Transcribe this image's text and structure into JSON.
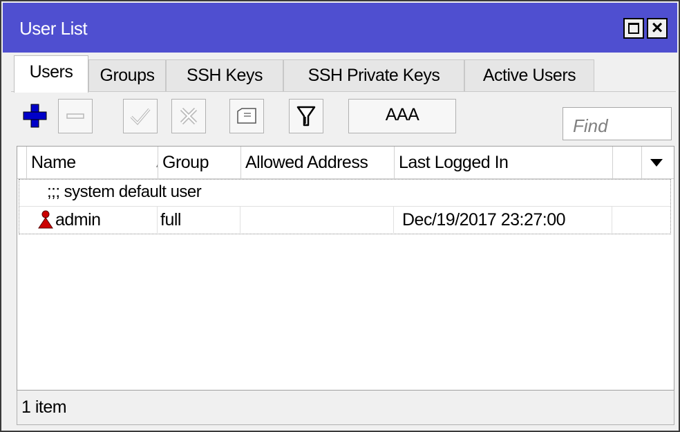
{
  "window": {
    "title": "User List"
  },
  "tabs": [
    {
      "label": "Users",
      "active": true
    },
    {
      "label": "Groups",
      "active": false
    },
    {
      "label": "SSH Keys",
      "active": false
    },
    {
      "label": "SSH Private Keys",
      "active": false
    },
    {
      "label": "Active Users",
      "active": false
    }
  ],
  "toolbar": {
    "icons": [
      "add-icon",
      "remove-icon",
      "enable-icon",
      "disable-icon",
      "comment-icon",
      "filter-icon"
    ],
    "aaa_label": "AAA",
    "find_placeholder": "Find"
  },
  "table": {
    "columns": [
      "Name",
      "Group",
      "Allowed Address",
      "Last Logged In"
    ],
    "rows": [
      {
        "comment": ";;; system default user",
        "name": "admin",
        "group": "full",
        "allowed_address": "",
        "last_logged_in": "Dec/19/2017 23:27:00"
      }
    ]
  },
  "status": {
    "text": "1 item"
  },
  "colors": {
    "titlebar": "#4f4fd0",
    "add_icon": "#0000c8",
    "user_icon": "#cc0000"
  }
}
